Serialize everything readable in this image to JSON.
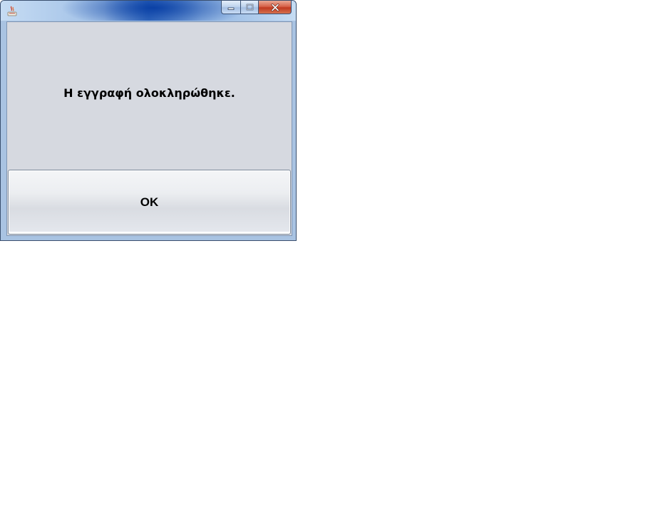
{
  "window": {
    "title": ""
  },
  "icons": {
    "app": "java-app-icon",
    "minimize": "minimize-icon",
    "maximize": "maximize-icon",
    "close": "close-icon"
  },
  "dialog": {
    "message": "Η εγγραφή ολοκληρώθηκε.",
    "ok_label": "OK"
  },
  "colors": {
    "content_background": "#d6d9e0",
    "close_button": "#c03a20",
    "titlebar_accent": "#3f74c4"
  }
}
